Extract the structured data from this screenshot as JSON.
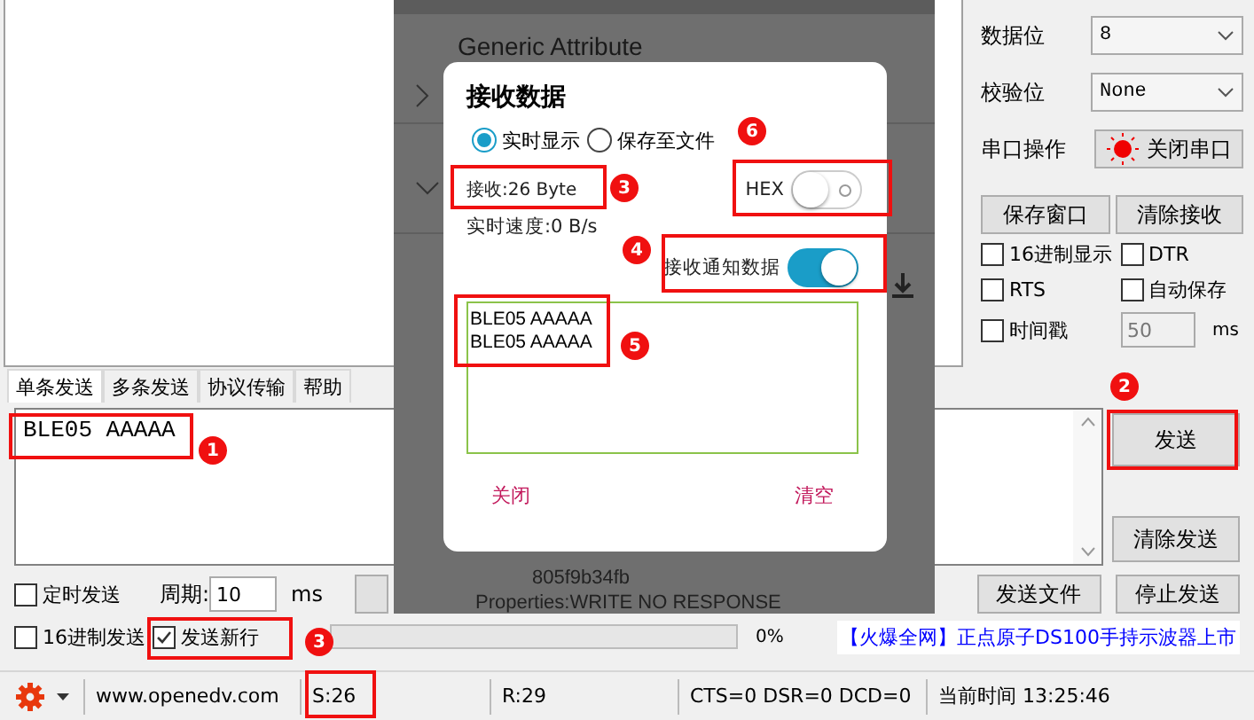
{
  "serial_settings": {
    "fields": [
      {
        "label": "数据位",
        "value": "8"
      },
      {
        "label": "校验位",
        "value": "None"
      }
    ],
    "port_operation": {
      "label": "串口操作",
      "button": "关闭串口",
      "open": true
    },
    "buttons": [
      "保存窗口",
      "清除接收"
    ],
    "options": [
      {
        "label": "16进制显示",
        "checked": false
      },
      {
        "label": "DTR",
        "checked": false
      },
      {
        "label": "RTS",
        "checked": false
      },
      {
        "label": "自动保存",
        "checked": false
      },
      {
        "label": "时间戳",
        "checked": false
      }
    ],
    "timestamp": {
      "value": "50",
      "unit": "ms",
      "disabled": true
    }
  },
  "tabs": [
    {
      "label": "单条发送",
      "selected": true
    },
    {
      "label": "多条发送",
      "selected": false
    },
    {
      "label": "协议传输",
      "selected": false
    },
    {
      "label": "帮助",
      "selected": false
    }
  ],
  "send": {
    "value": "BLE05 AAAAA",
    "buttons": [
      "发送",
      "清除发送"
    ]
  },
  "send_options": {
    "timed_send": {
      "label": "定时发送",
      "checked": false
    },
    "period_label": "周期:",
    "period": "10",
    "unit": "ms",
    "buttons": [
      "发送文件",
      "停止发送"
    ],
    "hex_send": {
      "label": "16进制发送",
      "checked": false
    },
    "new_line": {
      "label": "发送新行",
      "checked": true
    },
    "progress": {
      "level": 0,
      "reading": "0%"
    },
    "ad_link": "【火爆全网】正点原子DS100手持示波器上市"
  },
  "status_bar": {
    "website": "www.openedv.com",
    "sent": "S:26",
    "received": "R:29",
    "signals": "CTS=0 DSR=0 DCD=0",
    "time": "当前时间 13:25:46"
  },
  "phone": {
    "section_title": "Generic Attribute",
    "uuid_fragment": "805f9b34fb",
    "properties": "Properties:WRITE NO RESPONSE",
    "dialog": {
      "title": "接收数据",
      "modes": [
        {
          "label": "实时显示",
          "selected": true
        },
        {
          "label": "保存至文件",
          "selected": false
        }
      ],
      "received": "接收:26 Byte",
      "speed": "实时速度:0 B/s",
      "hex": {
        "label": "HEX",
        "on": false
      },
      "notify": {
        "label": "接收通知数据",
        "on": true
      },
      "log": [
        "BLE05 AAAAA",
        "BLE05 AAAAA"
      ],
      "buttons": [
        "关闭",
        "清空"
      ]
    }
  },
  "annotations": [
    "1",
    "2",
    "3",
    "3",
    "4",
    "5",
    "6"
  ]
}
